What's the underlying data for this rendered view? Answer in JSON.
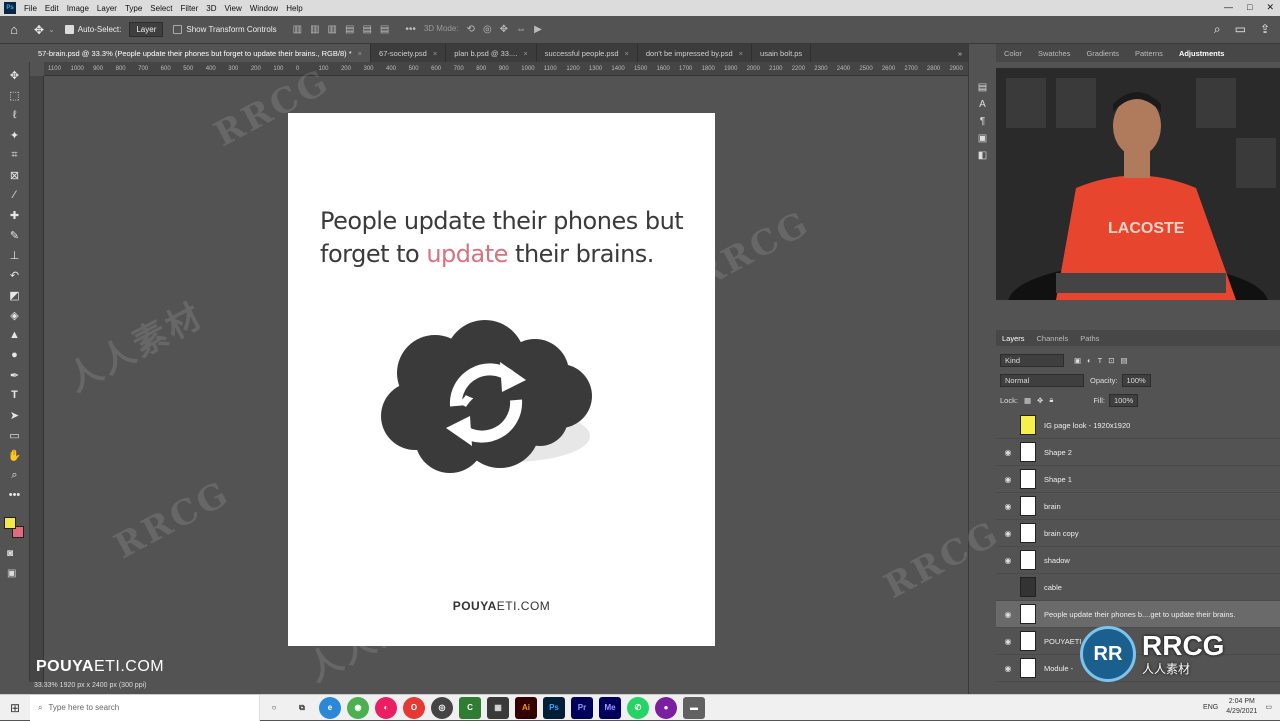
{
  "menubar": {
    "items": [
      "File",
      "Edit",
      "Image",
      "Layer",
      "Type",
      "Select",
      "Filter",
      "3D",
      "View",
      "Window",
      "Help"
    ],
    "window_controls": [
      "—",
      "□",
      "✕"
    ]
  },
  "options": {
    "auto_select_label": "Auto-Select:",
    "auto_select_value": "Layer",
    "show_transform_label": "Show Transform Controls",
    "mode_3d_label": "3D Mode:"
  },
  "tabs": [
    {
      "label": "57-brain.psd @ 33.3% (People update their phones but forget to update their brains., RGB/8) *",
      "active": true
    },
    {
      "label": "67-society.psd",
      "active": false
    },
    {
      "label": "plan b.psd @ 33....",
      "active": false
    },
    {
      "label": "successful people.psd",
      "active": false
    },
    {
      "label": "don't be impressed by.psd",
      "active": false
    },
    {
      "label": "usain bolt.ps",
      "active": false
    }
  ],
  "ruler_labels": [
    "1100",
    "1000",
    "900",
    "800",
    "700",
    "600",
    "500",
    "400",
    "300",
    "200",
    "100",
    "0",
    "100",
    "200",
    "300",
    "400",
    "500",
    "600",
    "700",
    "800",
    "900",
    "1000",
    "1100",
    "1200",
    "1300",
    "1400",
    "1500",
    "1600",
    "1700",
    "1800",
    "1900",
    "2000",
    "2100",
    "2200",
    "2300",
    "2400",
    "2500",
    "2600",
    "2700",
    "2800",
    "2900"
  ],
  "canvas": {
    "headline_line1": "People update their phones but",
    "headline_line2_pre": "forget to ",
    "headline_accent": "update",
    "headline_line2_post": " their brains.",
    "footer_brand_bold": "POUYA",
    "footer_brand_rest": "ETI.COM"
  },
  "video_overlay_brand_bold": "POUYA",
  "video_overlay_brand_rest": "ETI.COM",
  "status": "33.33%  1920 px x 2400 px (300 ppi)",
  "top_panel": {
    "tabs": [
      "Color",
      "Swatches",
      "Gradients",
      "Patterns",
      "Adjustments"
    ],
    "active": "Adjustments"
  },
  "webcam_shirt_text": "LACOSTE",
  "layers_panel": {
    "tabs": [
      "Layers",
      "Channels",
      "Paths"
    ],
    "kind_label": "Kind",
    "blend_mode": "Normal",
    "opacity_label": "Opacity:",
    "opacity_value": "100%",
    "lock_label": "Lock:",
    "fill_label": "Fill:",
    "fill_value": "100%",
    "layers": [
      {
        "name": "IG page look - 1920x1920",
        "visible": false,
        "selected": false
      },
      {
        "name": "Shape 2",
        "visible": true,
        "selected": false
      },
      {
        "name": "Shape 1",
        "visible": true,
        "selected": false
      },
      {
        "name": "brain",
        "visible": true,
        "selected": false
      },
      {
        "name": "brain copy",
        "visible": true,
        "selected": false
      },
      {
        "name": "shadow",
        "visible": true,
        "selected": false
      },
      {
        "name": "cable",
        "visible": false,
        "selected": false
      },
      {
        "name": "People update their phones b....get to update their brains.",
        "visible": true,
        "selected": true
      },
      {
        "name": "POUYAETI",
        "visible": true,
        "selected": false
      },
      {
        "name": "Module -",
        "visible": true,
        "selected": false
      }
    ]
  },
  "taskbar": {
    "search_placeholder": "Type here to search",
    "apps": [
      "Ai",
      "Ps",
      "Pr",
      "Me"
    ],
    "lang": "ENG",
    "time": "2:04 PM",
    "date": "4/29/2021"
  },
  "watermarks": [
    "RRCG",
    "人人素材",
    "RRCG",
    "人人素材",
    "RRCG",
    "人人素材",
    "RRCG",
    "人人素材"
  ],
  "logo": {
    "mark": "RR",
    "title": "RRCG",
    "subtitle": "人人素材"
  },
  "colors": {
    "accent": "#d9727f",
    "foreground_swatch": "#f6e84a",
    "background_swatch": "#e06b7b",
    "ps_blue": "#31a8ff"
  }
}
